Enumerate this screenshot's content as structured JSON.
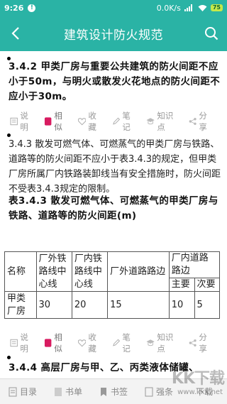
{
  "status_bar": {
    "time": "9:26",
    "alert": "!",
    "speed": "0.0K/s",
    "battery": "75"
  },
  "header": {
    "title": "建筑设计防火规范"
  },
  "sections": [
    {
      "bold_text": "3.4.2 甲类厂房与重要公共建筑的防火间距不应小于50m，与明火或散发火花地点的防火间距不应小于30m。"
    },
    {
      "text": "3.4.3 散发可燃气体、可燃蒸气的甲类厂房与铁路、道路等的防火间距不应小于表3.4.3的规定，但甲类厂房所属厂内铁路装卸线当有安全措施时，防火间距不受表3.4.3规定的限制。"
    },
    {
      "bold_text": "3.4.4 高层厂房与甲、乙、丙类液体储罐、"
    }
  ],
  "table_title": "表3.4.3 散发可燃气体、可燃蒸气的甲类厂房与铁路、道路等的防火间距(m)",
  "table": {
    "h_name": "名称",
    "h_outer_rail": "厂外铁路线中心线",
    "h_inner_rail": "厂内铁路线中心线",
    "h_outer_road": "厂外道路路边",
    "h_inner_road": "厂内道路路边",
    "h_main": "主要",
    "h_secondary": "次要",
    "row_name": "甲类厂房",
    "v_outer_rail": "30",
    "v_inner_rail": "20",
    "v_outer_road": "15",
    "v_main": "10",
    "v_secondary": "5"
  },
  "actions": {
    "explain": "说明",
    "similar": "相似",
    "favorite": "收藏",
    "notes": "笔记",
    "knowledge": "知识点",
    "share": "分享"
  },
  "bottom_nav": {
    "catalog": "目录",
    "booklist": "书单",
    "bookmark": "书签",
    "strong": "强条",
    "download": "下载"
  },
  "watermark": {
    "main": "KK下载",
    "sub": "www.kkx.net"
  }
}
